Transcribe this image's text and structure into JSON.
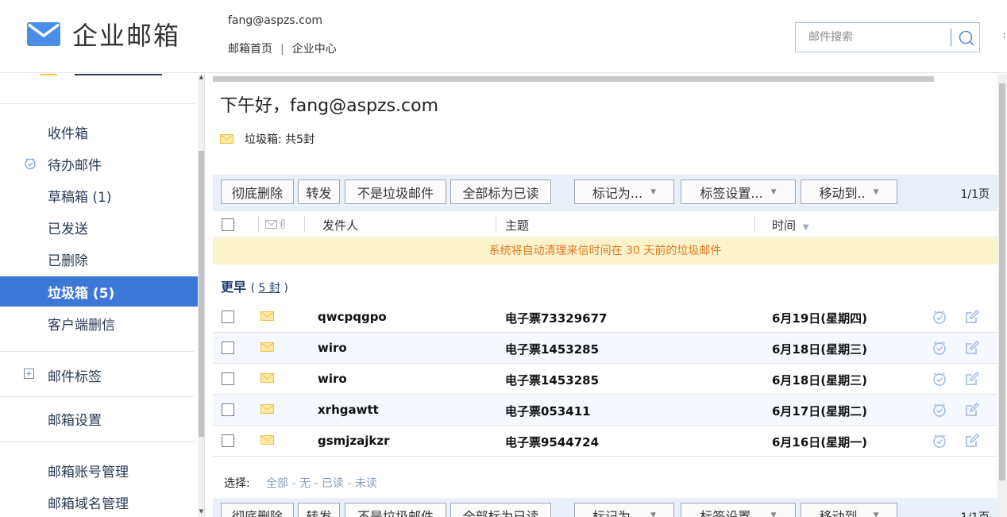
{
  "header": {
    "logo_text": "企业邮箱",
    "user_email": "fang@aspzs.com",
    "links": [
      {
        "label": "邮箱首页"
      },
      {
        "label": "企业中心"
      }
    ],
    "link_separator": "|",
    "search_placeholder": "邮件搜索",
    "edge_char": "∶"
  },
  "sidebar": {
    "items": [
      {
        "label": "收件箱",
        "icon": ""
      },
      {
        "label": "待办邮件",
        "icon": "clock-check-icon"
      },
      {
        "label": "草稿箱 (1)",
        "icon": ""
      },
      {
        "label": "已发送",
        "icon": ""
      },
      {
        "label": "已删除",
        "icon": ""
      },
      {
        "label": "垃圾箱 (5)",
        "icon": "",
        "active": true
      },
      {
        "label": "客户端删信",
        "icon": ""
      },
      {
        "label": "邮件标签",
        "icon": "expand-plus-icon"
      },
      {
        "label": "邮箱设置",
        "icon": ""
      },
      {
        "label": "邮箱账号管理",
        "icon": ""
      },
      {
        "label": "邮箱域名管理",
        "icon": ""
      }
    ]
  },
  "main": {
    "greeting": "下午好，fang@aspzs.com",
    "folder_summary": "垃圾箱: 共5封",
    "toolbar": {
      "buttons": [
        "彻底删除",
        "转发",
        "不是垃圾邮件",
        "全部标为已读"
      ],
      "dropdowns": [
        "标记为...",
        "标签设置...",
        "移动到.."
      ],
      "page_info": "1/1页"
    },
    "list_header": {
      "sender": "发件人",
      "subject": "主题",
      "time": "时间"
    },
    "notice": "系统将自动清理来信时间在 30 天前的垃圾邮件",
    "group": {
      "label": "更早",
      "count_prefix": "(",
      "count": "5 封",
      "count_suffix": ")"
    },
    "rows": [
      {
        "sender": "qwcpqgpo",
        "subject": "电子票73329677",
        "time": "6月19日(星期四)"
      },
      {
        "sender": "wiro",
        "subject": "电子票1453285",
        "time": "6月18日(星期三)"
      },
      {
        "sender": "wiro",
        "subject": "电子票1453285",
        "time": "6月18日(星期三)"
      },
      {
        "sender": "xrhgawtt",
        "subject": "电子票053411",
        "time": "6月17日(星期二)"
      },
      {
        "sender": "gsmjzajkzr",
        "subject": "电子票9544724",
        "time": "6月16日(星期一)"
      }
    ],
    "select_bar": {
      "label": "选择:",
      "options": [
        "全部",
        "无",
        "已读",
        "未读"
      ],
      "separator": " - "
    }
  },
  "colors": {
    "accent": "#3d78d6",
    "toolbar_bg": "#e9f0fa",
    "notice_bg": "#fbf3c9",
    "notice_text": "#e07a2a",
    "envelope": "#f5c84c",
    "row_icon": "#9bb6e0"
  }
}
